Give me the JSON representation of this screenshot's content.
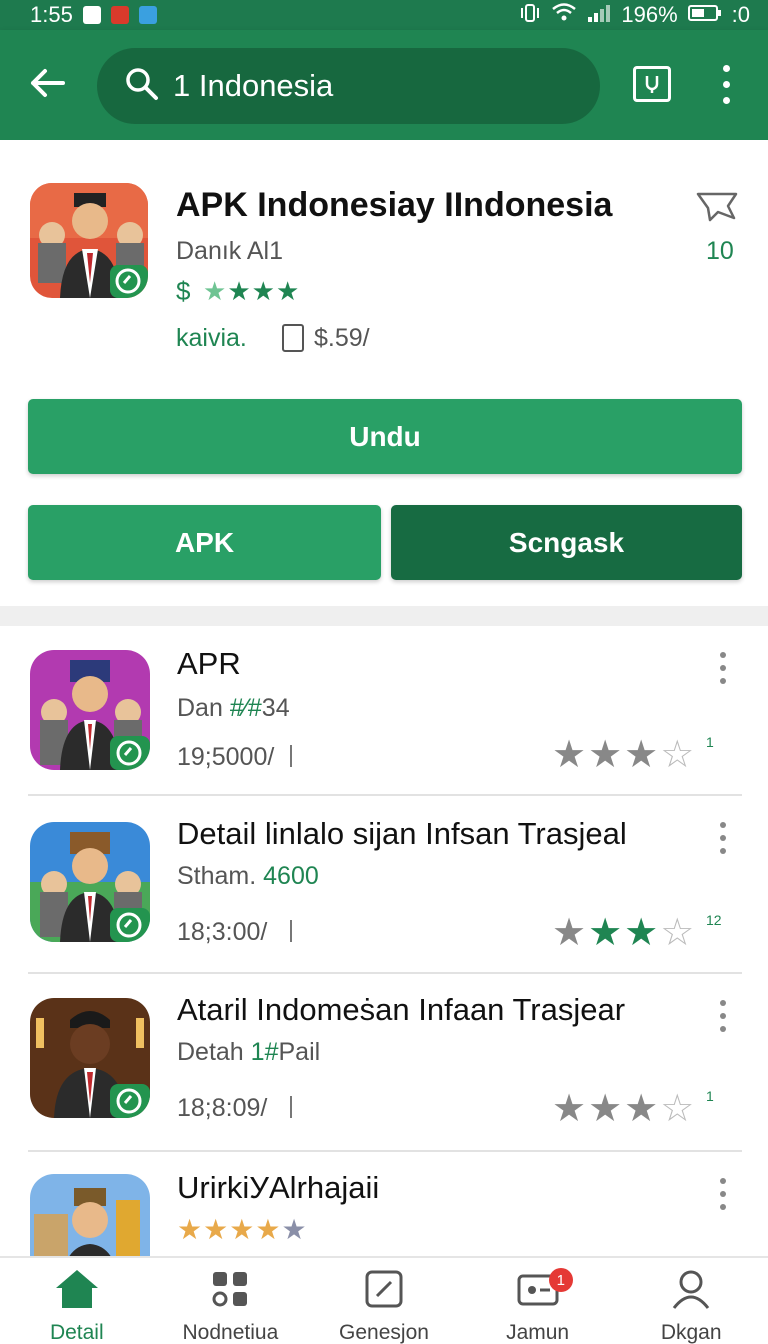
{
  "status_bar": {
    "time": "1:55",
    "battery": "196%",
    "extra": ":0"
  },
  "search": {
    "query": "1 Indonesia"
  },
  "header": {
    "title": "APK Indonesiaу IIndonesia",
    "developer": "Danık Al1",
    "price": "$",
    "rating_stars": 4,
    "link_text": "kaivia.",
    "size": "$.59/",
    "count": "10",
    "install_label": "Undu",
    "apk_label": "APK",
    "share_label": "Scngask"
  },
  "list": [
    {
      "title": "APR",
      "sub_prefix": "Dan ",
      "sub_green": "#⁄#",
      "sub_suffix": "34",
      "meta": "19;5000/",
      "rating_num": "1",
      "stars": [
        "gr",
        "gr",
        "gr",
        "o-half"
      ]
    },
    {
      "title": "Detail linlalo sijan Infsan Trasjeal",
      "sub_prefix": "Stham. ",
      "sub_green": "4600",
      "sub_suffix": "",
      "meta": "18;3:00/",
      "rating_num": "12",
      "stars": [
        "gr",
        "g",
        "g",
        "o"
      ]
    },
    {
      "title": "Ataril Indomeṡan Infaan Trasjear",
      "sub_prefix": "Detah ",
      "sub_green": "1#",
      "sub_suffix": "Pail",
      "meta": "18;8:09/",
      "rating_num": "1",
      "stars": [
        "gr",
        "gr",
        "gr",
        "o"
      ]
    },
    {
      "title": "UrirkiУAlrhajaii",
      "stars_colored": true
    }
  ],
  "bottom_nav": [
    {
      "label": "Detail",
      "icon": "home-icon",
      "active": true
    },
    {
      "label": "Nodnetiua",
      "icon": "apps-icon",
      "active": false
    },
    {
      "label": "Genesjon",
      "icon": "edit-icon",
      "active": false
    },
    {
      "label": "Jamun",
      "icon": "ticket-icon",
      "active": false,
      "badge": "1"
    },
    {
      "label": "Dkgan",
      "icon": "person-icon",
      "active": false
    }
  ],
  "colors": {
    "primary": "#1f8552",
    "primary_dark": "#17683f",
    "accent": "#29a066"
  }
}
